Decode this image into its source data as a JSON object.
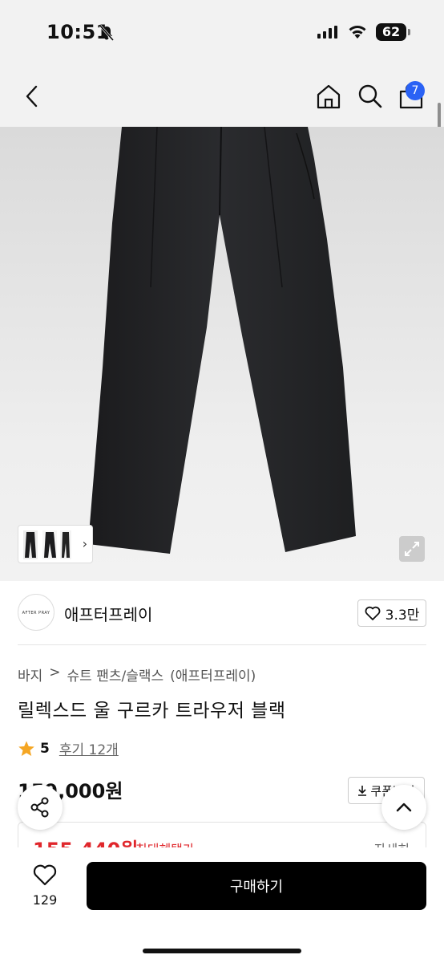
{
  "status": {
    "time": "10:51",
    "battery": "62"
  },
  "nav": {
    "cart_count": "7"
  },
  "seller": {
    "logo_text": "AFTER PRAY",
    "name": "애프터프레이",
    "likes": "3.3만"
  },
  "breadcrumb": [
    "바지",
    ">",
    "슈트 팬츠/슬랙스",
    "(애프터프레이)"
  ],
  "product": {
    "title": "릴렉스드 울 구르카 트라우저 블랙",
    "rating": "5",
    "reviews": "후기 12개",
    "price": "159,000원",
    "coupon": "쿠폰받기"
  },
  "benefit": {
    "price": "155,440원",
    "label": "최대혜택가",
    "detail": "자세히"
  },
  "bottom": {
    "wish_count": "129",
    "buy_label": "구매하기"
  },
  "colors": {
    "accent_red": "#e0262b",
    "badge_blue": "#2a62f5",
    "star": "#f5a623"
  }
}
